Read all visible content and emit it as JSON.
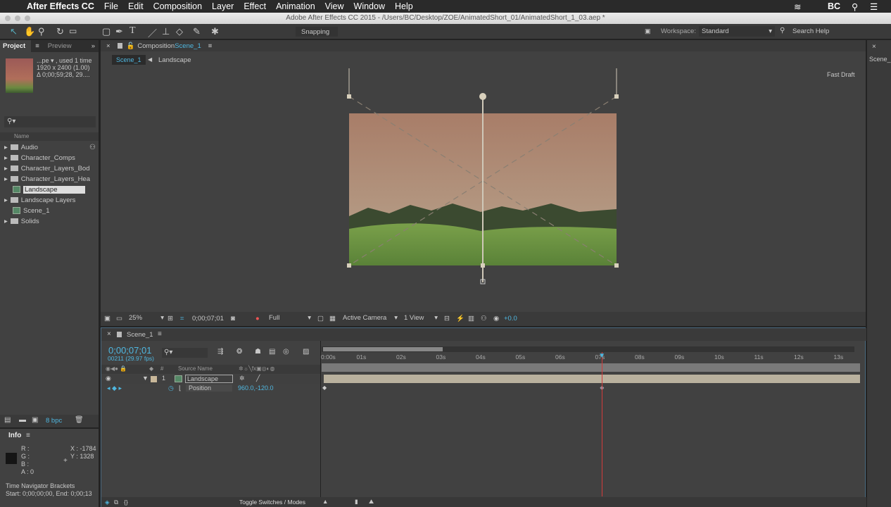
{
  "menubar": {
    "app": "After Effects CC",
    "items": [
      "File",
      "Edit",
      "Composition",
      "Layer",
      "Effect",
      "Animation",
      "View",
      "Window",
      "Help"
    ],
    "user": "BC"
  },
  "titlebar": {
    "title": "Adobe After Effects CC 2015 - /Users/BC/Desktop/ZOE/AnimatedShort_01/AnimatedShort_1_03.aep *"
  },
  "toolbar": {
    "snapping": "Snapping",
    "workspace_label": "Workspace:",
    "workspace": "Standard",
    "search_help": "Search Help"
  },
  "project": {
    "tab_project": "Project",
    "tab_preview": "Preview",
    "info_line1": "...pe ▾ , used 1 time",
    "info_line2": "1920 x 2400 (1.00)",
    "info_line3": "Δ 0;00;59;28, 29....",
    "search_placeholder": "⚲▾",
    "col_name": "Name",
    "items": [
      {
        "label": "Audio",
        "type": "folder"
      },
      {
        "label": "Character_Comps",
        "type": "folder"
      },
      {
        "label": "Character_Layers_Bodi",
        "type": "folder"
      },
      {
        "label": "Character_Layers_Head",
        "type": "folder"
      },
      {
        "label": "Landscape",
        "type": "comp",
        "selected": true
      },
      {
        "label": "Landscape Layers",
        "type": "folder"
      },
      {
        "label": "Scene_1",
        "type": "comp"
      },
      {
        "label": "Solids",
        "type": "folder"
      }
    ],
    "bpc": "8 bpc"
  },
  "info": {
    "title": "Info",
    "r": "R :",
    "g": "G :",
    "b": "B :",
    "a": "A : 0",
    "x": "X : -1784",
    "y": "Y : 1328",
    "nav_title": "Time Navigator Brackets",
    "nav_range": "Start: 0;00;00;00, End: 0;00;13"
  },
  "comp": {
    "tab_label": "Composition",
    "tab_name": "Scene_1",
    "crumb1": "Scene_1",
    "crumb2": "Landscape",
    "fast_draft": "Fast Draft",
    "zoom": "25%",
    "timecode": "0;00;07;01",
    "resolution": "Full",
    "camera": "Active Camera",
    "views": "1 View",
    "exposure": "+0.0"
  },
  "right_panel": {
    "tab": "Scene_"
  },
  "timeline": {
    "tab": "Scene_1",
    "timecode": "0;00;07;01",
    "frames": "00211 (29.97 fps)",
    "col_source": "Source Name",
    "col_num": "#",
    "layer_num": "1",
    "layer_name": "Landscape",
    "prop_name": "Position",
    "prop_value": "960.0,-120.0",
    "toggle": "Toggle Switches / Modes",
    "ruler": [
      "0:00s",
      "01s",
      "02s",
      "03s",
      "04s",
      "05s",
      "06s",
      "07s",
      "08s",
      "09s",
      "10s",
      "11s",
      "12s",
      "13s"
    ],
    "playhead_seconds": 7.03,
    "work_area_seconds": [
      0,
      3
    ]
  },
  "colors": {
    "accent": "#4fb7e0",
    "playhead": "#d33b3b",
    "layer_bar": "#b9b19e"
  }
}
